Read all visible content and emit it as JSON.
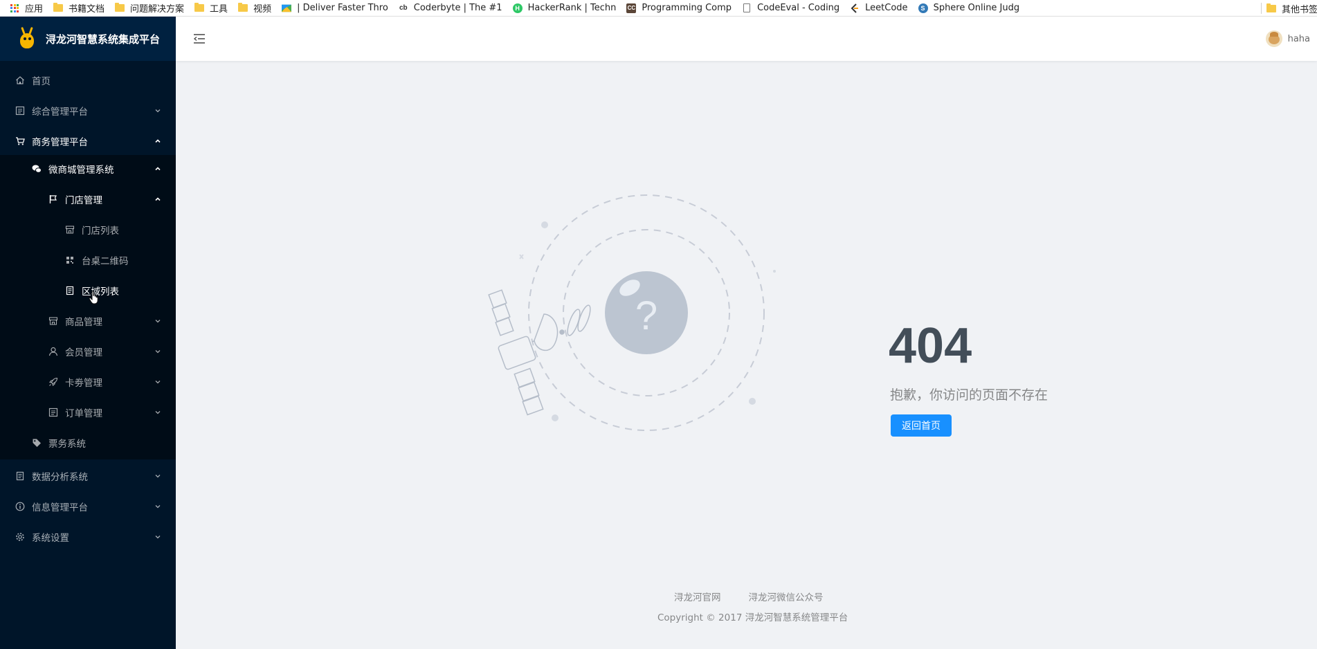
{
  "bookmarks": [
    {
      "label": "应用",
      "icon": "apps-grid-icon"
    },
    {
      "label": "书籍文档",
      "icon": "folder-icon"
    },
    {
      "label": "问题解决方案",
      "icon": "folder-icon"
    },
    {
      "label": "工具",
      "icon": "folder-icon"
    },
    {
      "label": "视频",
      "icon": "folder-icon"
    },
    {
      "label": "| Deliver Faster Thro",
      "icon": "site-icon"
    },
    {
      "label": "Coderbyte | The #1",
      "icon": "coderbyte-icon"
    },
    {
      "label": "HackerRank | Techn",
      "icon": "hackerrank-icon"
    },
    {
      "label": "Programming Comp",
      "icon": "codechef-icon"
    },
    {
      "label": "CodeEval - Coding",
      "icon": "page-icon"
    },
    {
      "label": "LeetCode",
      "icon": "leetcode-icon"
    },
    {
      "label": "Sphere Online Judg",
      "icon": "spoj-icon"
    }
  ],
  "bookmarks_other": "其他书签",
  "app": {
    "title": "浔龙河智慧系统集成平台"
  },
  "menu": {
    "home": "首页",
    "general_platform": "综合管理平台",
    "business_platform": "商务管理平台",
    "wechat_mall": "微商城管理系统",
    "store_mgmt": "门店管理",
    "store_list": "门店列表",
    "table_qrcode": "台桌二维码",
    "area_list": "区域列表",
    "goods_mgmt": "商品管理",
    "member_mgmt": "会员管理",
    "coupon_mgmt": "卡劵管理",
    "order_mgmt": "订单管理",
    "ticket_system": "票务系统",
    "data_analysis": "数据分析系统",
    "info_platform": "信息管理平台",
    "settings": "系统设置"
  },
  "header": {
    "user_name": "haha"
  },
  "exception": {
    "code": "404",
    "description": "抱歉，你访问的页面不存在",
    "back_label": "返回首页"
  },
  "footer": {
    "link_site": "浔龙河官网",
    "link_wechat": "浔龙河微信公众号",
    "copyright": "Copyright © 2017 浔龙河智慧系统管理平台"
  },
  "colors": {
    "sidebar_bg": "#001529",
    "sidebar_logo_bg": "#002140",
    "submenu_bg": "#000c17",
    "primary": "#1890ff",
    "page_bg": "#f0f2f5",
    "code_text": "#434e59"
  }
}
